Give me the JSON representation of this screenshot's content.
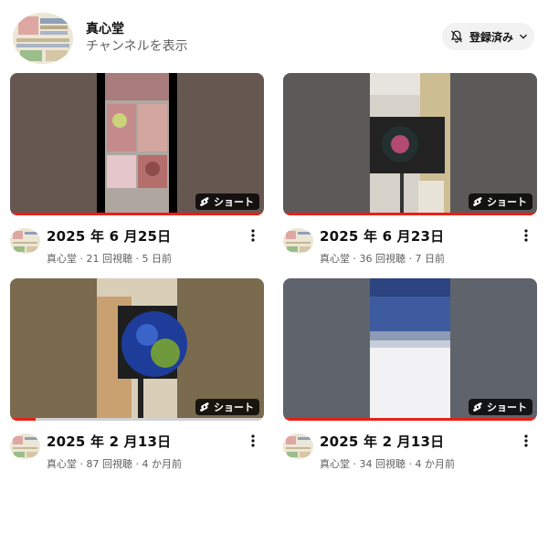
{
  "channel": {
    "name": "真心堂",
    "show_channel_label": "チャンネルを表示",
    "subscribe_label": "登録済み"
  },
  "videos": [
    {
      "title": "2025 年 6 月25日",
      "meta": "真心堂 · 21 回視聴 · 5 日前",
      "badge": "ショート",
      "progress": 1.0
    },
    {
      "title": "2025 年 6 月23日",
      "meta": "真心堂 · 36 回視聴 · 7 日前",
      "badge": "ショート",
      "progress": 1.0
    },
    {
      "title": "2025 年 2 月13日",
      "meta": "真心堂 · 87 回視聴 · 4 か月前",
      "badge": "ショート",
      "progress": 0.1
    },
    {
      "title": "2025 年 2 月13日",
      "meta": "真心堂 · 34 回視聴 · 4 か月前",
      "badge": "ショート",
      "progress": 1.0
    }
  ],
  "colors": {
    "progress": "#e62117",
    "secondary_text": "#606060",
    "button_bg": "#f2f2f2"
  },
  "icons": {
    "subscribe": "bell-off-icon",
    "dropdown": "chevron-down-icon",
    "more": "more-vert-icon",
    "shorts": "shorts-logo-icon"
  }
}
